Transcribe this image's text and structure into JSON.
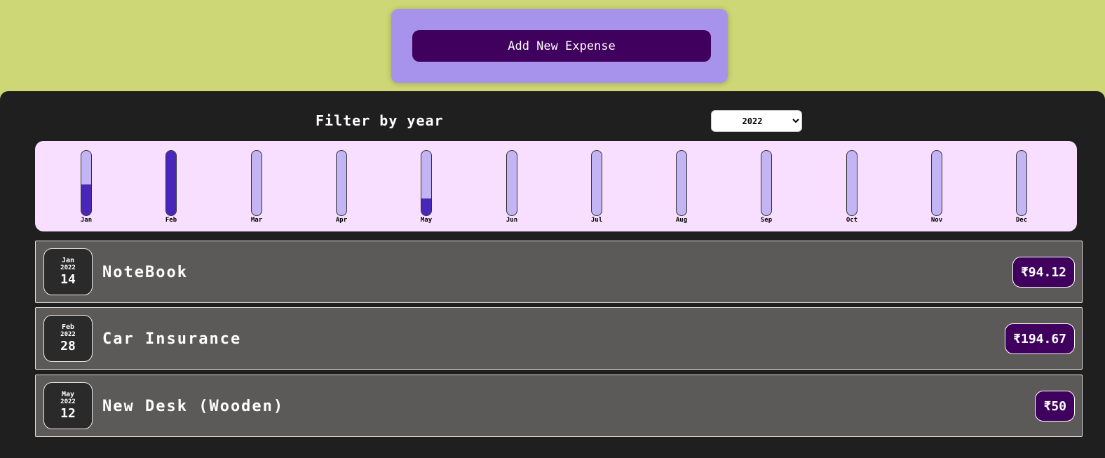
{
  "new_expense": {
    "button_label": "Add New Expense"
  },
  "filter": {
    "label": "Filter by year",
    "selected_year": "2022",
    "options": [
      "2022"
    ]
  },
  "chart_data": {
    "type": "bar",
    "categories": [
      "Jan",
      "Feb",
      "Mar",
      "Apr",
      "May",
      "Jun",
      "Jul",
      "Aug",
      "Sep",
      "Oct",
      "Nov",
      "Dec"
    ],
    "values": [
      94.12,
      194.67,
      0,
      0,
      50,
      0,
      0,
      0,
      0,
      0,
      0,
      0
    ],
    "max": 194.67
  },
  "expenses": [
    {
      "month": "Jan",
      "year": "2022",
      "day": "14",
      "title": "NoteBook",
      "amount": "₹94.12"
    },
    {
      "month": "Feb",
      "year": "2022",
      "day": "28",
      "title": "Car Insurance",
      "amount": "₹194.67"
    },
    {
      "month": "May",
      "year": "2022",
      "day": "12",
      "title": "New Desk (Wooden)",
      "amount": "₹50"
    }
  ],
  "colors": {
    "page_background": "#cdd775",
    "panel_background": "#a893ec",
    "button": "#40005d",
    "dark_background": "#1f1f1f",
    "chart_background": "#f8dfff",
    "bar_empty": "#c3b4f3",
    "bar_fill": "#4826b9",
    "item_background": "#5c5959"
  }
}
